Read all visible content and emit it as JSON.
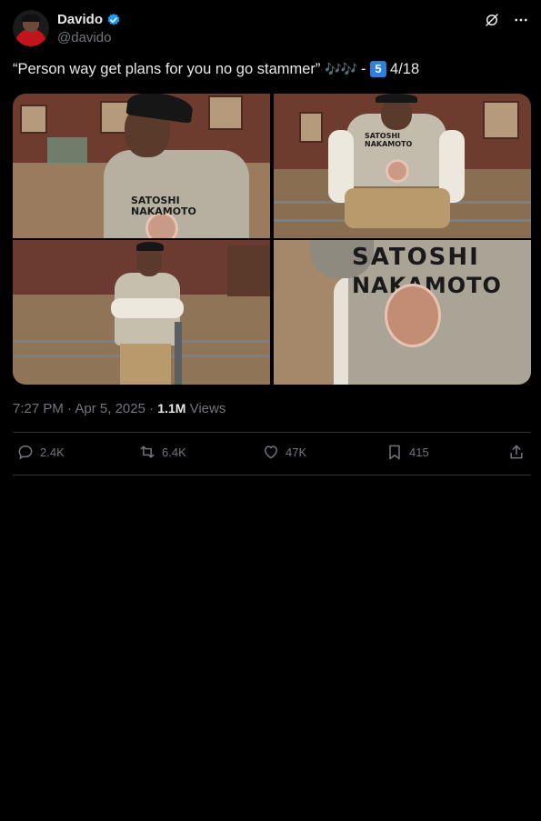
{
  "author": {
    "name": "Davido",
    "handle": "@davido"
  },
  "tweet": {
    "text_before": "“Person way get plans for you no go stammer”",
    "notes": "🎶🎶",
    "dash": "-",
    "badge_number": "5",
    "counter": "4/18"
  },
  "photos": [
    {
      "shirt_text": "SATOSHI NAKAMOTO"
    },
    {
      "shirt_text": "SATOSHI NAKAMOTO"
    },
    {
      "shirt_text": ""
    },
    {
      "shirt_text_line1": "SATOSHI",
      "shirt_text_line2": "NAKAMOTO"
    }
  ],
  "meta": {
    "time": "7:27 PM",
    "separator": "·",
    "date": "Apr 5, 2025",
    "views_count": "1.1M",
    "views_label": "Views"
  },
  "actions": {
    "replies": "2.4K",
    "reposts": "6.4K",
    "likes": "47K",
    "bookmarks": "415"
  },
  "icons": [
    "verified-badge-icon",
    "grok-icon",
    "more-icon",
    "reply-icon",
    "repost-icon",
    "like-icon",
    "bookmark-icon",
    "share-icon"
  ],
  "colors": {
    "background": "#000000",
    "text": "#e7e9ea",
    "secondary": "#71767b",
    "accent": "#1d9bf0",
    "divider": "#2f3336"
  }
}
